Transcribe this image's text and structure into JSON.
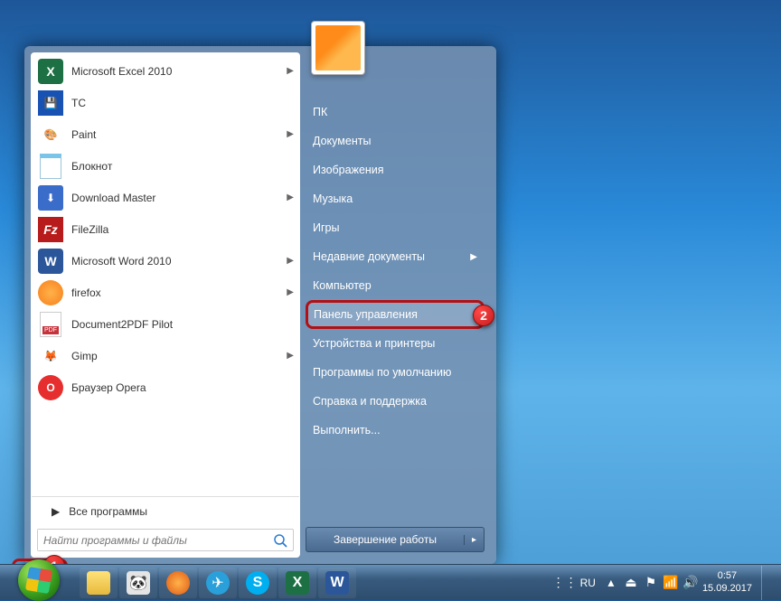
{
  "startMenu": {
    "programs": [
      {
        "label": "Microsoft Excel 2010",
        "icon": "excel",
        "hasSub": true
      },
      {
        "label": "TC",
        "icon": "tc",
        "hasSub": false
      },
      {
        "label": "Paint",
        "icon": "paint",
        "hasSub": true
      },
      {
        "label": "Блокнот",
        "icon": "notepad",
        "hasSub": false
      },
      {
        "label": "Download Master",
        "icon": "dm",
        "hasSub": true
      },
      {
        "label": "FileZilla",
        "icon": "filezilla",
        "hasSub": false
      },
      {
        "label": "Microsoft Word 2010",
        "icon": "word",
        "hasSub": true
      },
      {
        "label": "firefox",
        "icon": "firefox",
        "hasSub": true
      },
      {
        "label": "Document2PDF Pilot",
        "icon": "pdf",
        "hasSub": false
      },
      {
        "label": "Gimp",
        "icon": "gimp",
        "hasSub": true
      },
      {
        "label": "Браузер Opera",
        "icon": "opera",
        "hasSub": false
      }
    ],
    "allPrograms": "Все программы",
    "searchPlaceholder": "Найти программы и файлы",
    "rightItems": [
      {
        "label": "ПК",
        "hasSub": false
      },
      {
        "label": "Документы",
        "hasSub": false
      },
      {
        "label": "Изображения",
        "hasSub": false
      },
      {
        "label": "Музыка",
        "hasSub": false
      },
      {
        "label": "Игры",
        "hasSub": false
      },
      {
        "label": "Недавние документы",
        "hasSub": true
      },
      {
        "label": "Компьютер",
        "hasSub": false
      },
      {
        "label": "Панель управления",
        "hasSub": false,
        "highlight": true
      },
      {
        "label": "Устройства и принтеры",
        "hasSub": false
      },
      {
        "label": "Программы по умолчанию",
        "hasSub": false
      },
      {
        "label": "Справка и поддержка",
        "hasSub": false
      },
      {
        "label": "Выполнить...",
        "hasSub": false
      }
    ],
    "shutdown": "Завершение работы"
  },
  "taskbar": {
    "lang": "RU",
    "time": "0:57",
    "date": "15.09.2017"
  },
  "badges": {
    "one": "1",
    "two": "2"
  },
  "icons": {
    "excel": "#1d7044",
    "tc": "#1853b4",
    "paint": "#ffcf4a",
    "notepad": "#79c4e8",
    "dm": "#3a6cc9",
    "filezilla": "#b71b1b",
    "word": "#2b579a",
    "firefox": "#f77f1c",
    "pdf": "#c6333c",
    "gimp": "#8c7b64",
    "opera": "#e62e2e"
  }
}
